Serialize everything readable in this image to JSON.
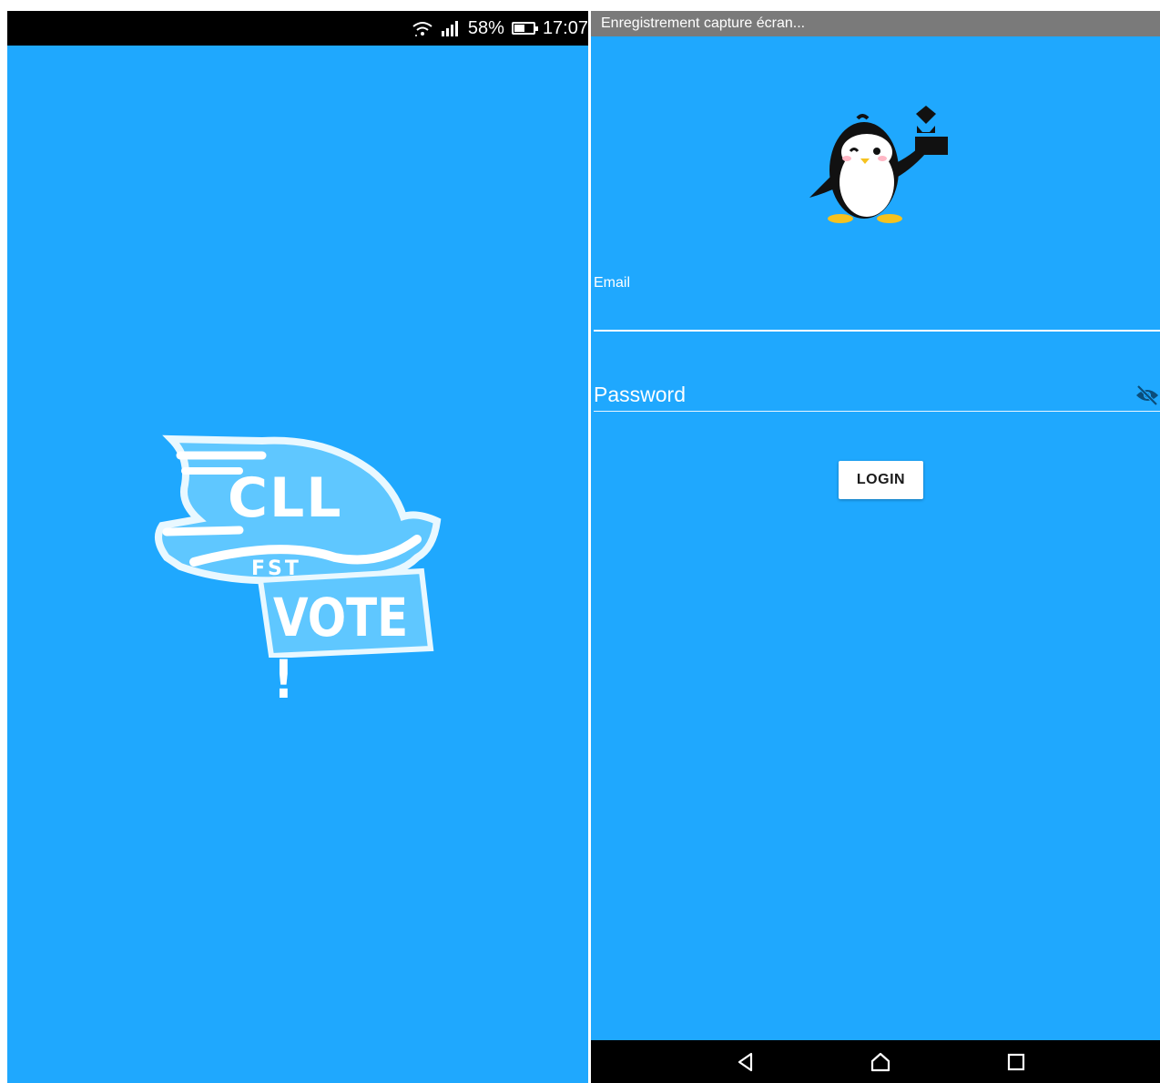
{
  "left_screen": {
    "status_bar": {
      "battery_percent_label": "58%",
      "battery_level": 0.58,
      "time": "17:07",
      "icons": [
        "wifi-icon",
        "signal-icon",
        "battery-icon"
      ]
    },
    "logo": {
      "text_main": "CLL",
      "text_sub": "FST",
      "text_vote": "VOTE !"
    },
    "background_color": "#1fa8fe"
  },
  "right_screen": {
    "recording_notification": "Enregistrement capture écran...",
    "email_label": "Email",
    "email_value": "",
    "password_placeholder": "Password",
    "login_label": "LOGIN",
    "icons": [
      "penguin-ballot-icon",
      "eye-off-icon",
      "back-icon",
      "home-icon",
      "recents-icon"
    ],
    "background_color": "#1fa8fe"
  }
}
